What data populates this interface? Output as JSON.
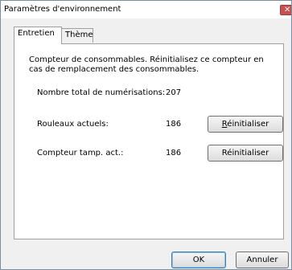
{
  "window": {
    "title": "Paramètres d'environnement"
  },
  "tabs": [
    {
      "label": "Entretien",
      "active": true
    },
    {
      "label": "Thème",
      "active": false
    }
  ],
  "maintenance": {
    "description": "Compteur de consommables. Réinitialisez ce compteur en cas de remplacement des consommables.",
    "rows": [
      {
        "label": "Nombre total de numérisations:",
        "value": "207"
      },
      {
        "label": "Rouleaux actuels:",
        "value": "186",
        "button": "Réinitialiser"
      },
      {
        "label": "Compteur tamp. act.:",
        "value": "186",
        "button": "Réinitialiser"
      }
    ]
  },
  "footer": {
    "ok_label": "OK",
    "cancel_label": "Annuler"
  },
  "colors": {
    "close_button": "#c75050",
    "default_button_border": "#3c7fb1"
  }
}
